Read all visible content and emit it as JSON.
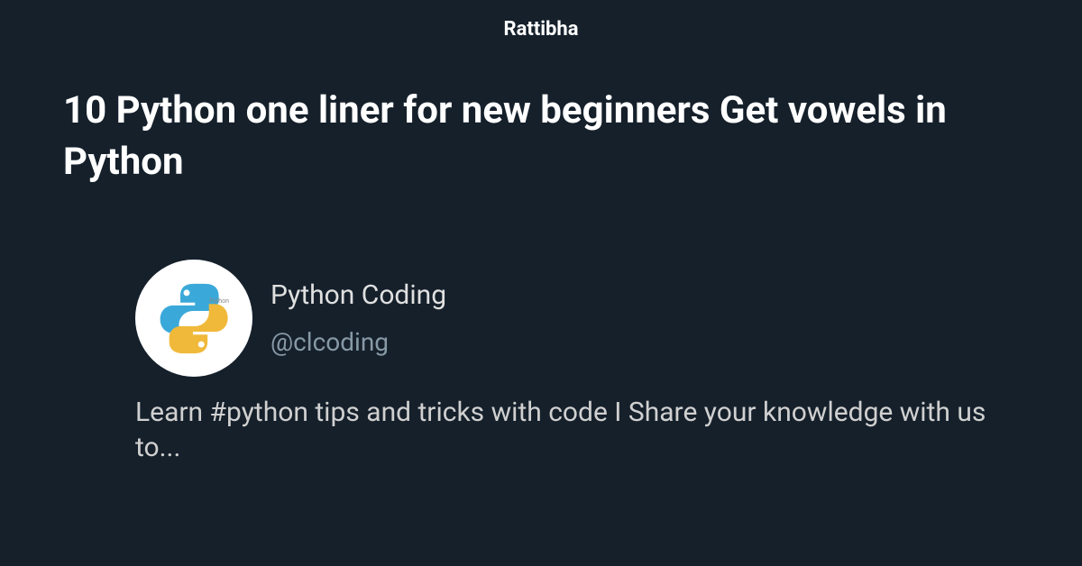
{
  "brand": "Rattibha",
  "title": "10 Python one liner for new beginners Get vowels in Python",
  "author": {
    "name": "Python Coding",
    "handle": "@clcoding",
    "logoLabel": "Python"
  },
  "description": "Learn #python tips and tricks with code I Share your knowledge with us to...",
  "colors": {
    "background": "#15202b",
    "pythonBlue": "#3776ab",
    "pythonYellow": "#ffd43b"
  }
}
